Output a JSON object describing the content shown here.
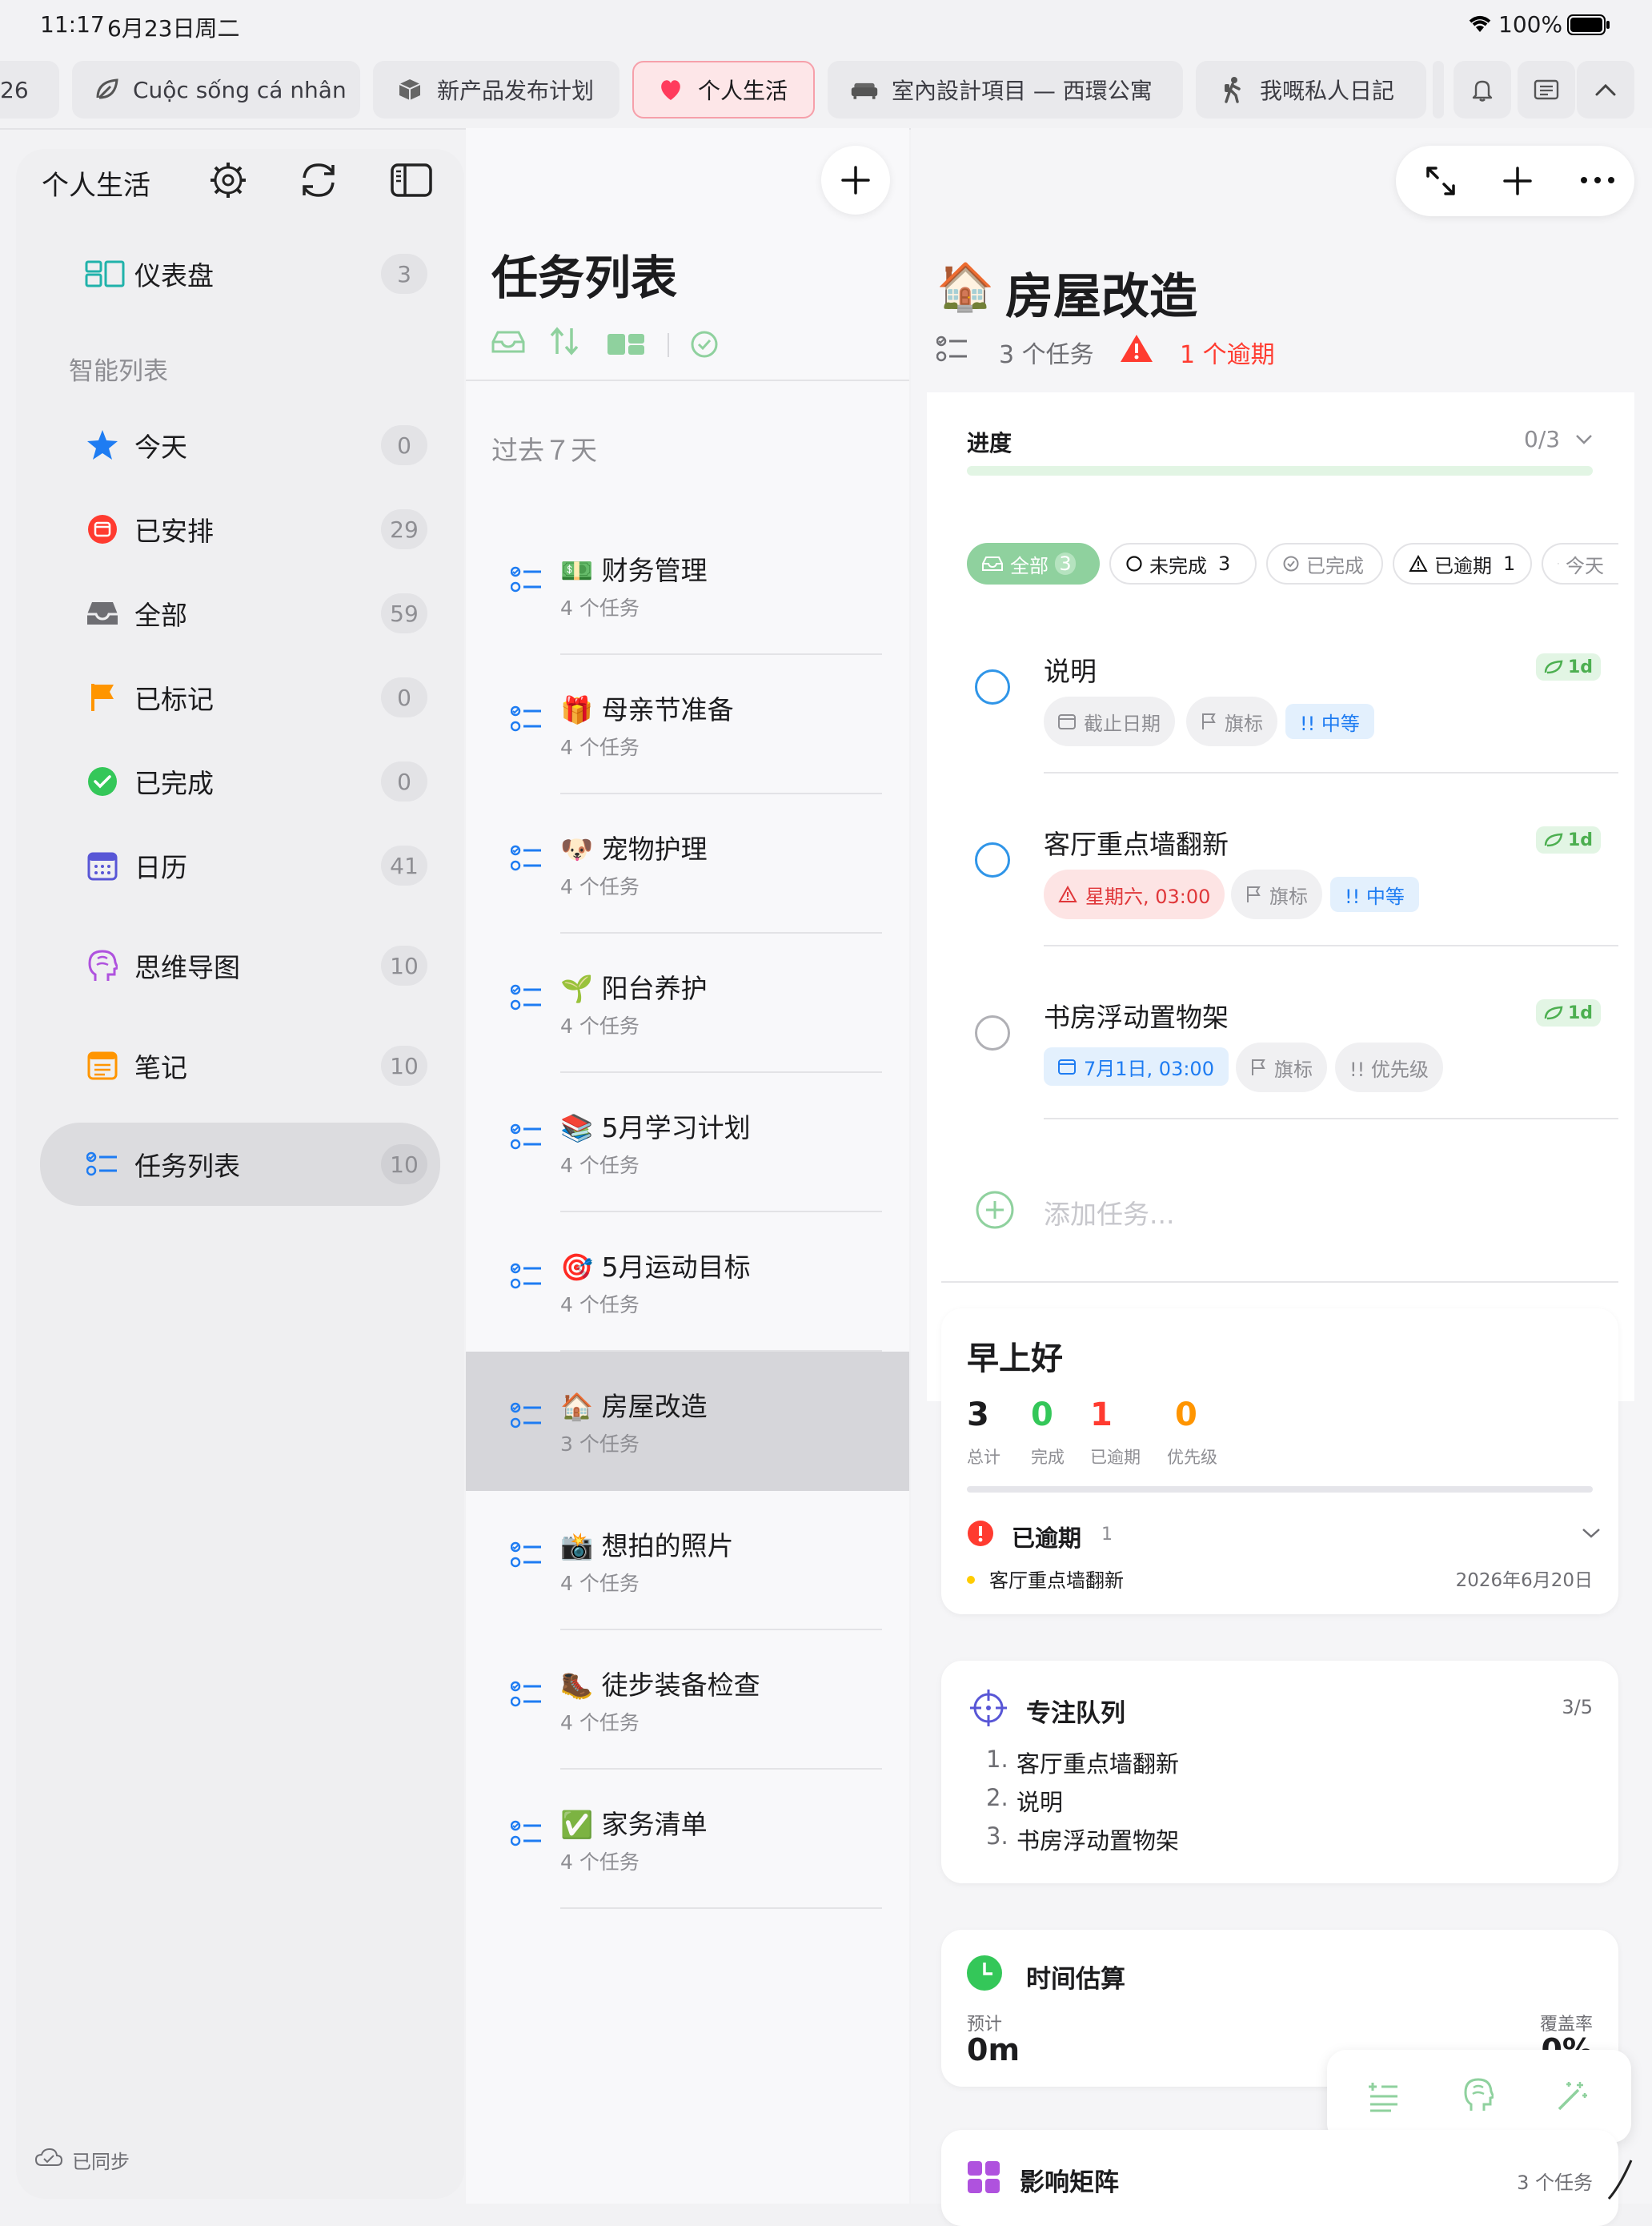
{
  "status": {
    "time": "11:17",
    "date": "6月23日周二",
    "battery": "100%"
  },
  "tabs": [
    {
      "label": "26",
      "icon": "partial-tab"
    },
    {
      "label": "Cuộc sống cá nhân",
      "icon": "leaf-icon"
    },
    {
      "label": "新产品发布计划",
      "icon": "box-icon"
    },
    {
      "label": "个人生活",
      "icon": "heart-icon",
      "active": true
    },
    {
      "label": "室內設計項目 — 西環公寓",
      "icon": "sofa-icon"
    },
    {
      "label": "我嘅私人日記",
      "icon": "hiker-icon"
    }
  ],
  "sidebar": {
    "title": "个人生活",
    "dashboard": {
      "label": "仪表盘",
      "count": "3"
    },
    "smart_header": "智能列表",
    "items": [
      {
        "label": "今天",
        "count": "0",
        "icon": "star-icon"
      },
      {
        "label": "已安排",
        "count": "29",
        "icon": "calendar-red-icon"
      },
      {
        "label": "全部",
        "count": "59",
        "icon": "inbox-icon"
      },
      {
        "label": "已标记",
        "count": "0",
        "icon": "flag-icon"
      },
      {
        "label": "已完成",
        "count": "0",
        "icon": "check-circle-icon"
      },
      {
        "label": "日历",
        "count": "41",
        "icon": "calendar-icon"
      },
      {
        "label": "思维导图",
        "count": "10",
        "icon": "brain-icon"
      },
      {
        "label": "笔记",
        "count": "10",
        "icon": "notes-icon"
      },
      {
        "label": "任务列表",
        "count": "10",
        "icon": "tasklist-icon"
      }
    ],
    "sync": "已同步"
  },
  "middle": {
    "title": "任务列表",
    "section": "过去７天",
    "lists": [
      {
        "emoji": "💵",
        "title": "财务管理",
        "sub": "4 个任务"
      },
      {
        "emoji": "🎁",
        "title": "母亲节准备",
        "sub": "4 个任务"
      },
      {
        "emoji": "🐶",
        "title": "宠物护理",
        "sub": "4 个任务"
      },
      {
        "emoji": "🌱",
        "title": "阳台养护",
        "sub": "4 个任务"
      },
      {
        "emoji": "📚",
        "title": "5月学习计划",
        "sub": "4 个任务"
      },
      {
        "emoji": "🎯",
        "title": "5月运动目标",
        "sub": "4 个任务"
      },
      {
        "emoji": "🏠",
        "title": "房屋改造",
        "sub": "3 个任务"
      },
      {
        "emoji": "📸",
        "title": "想拍的照片",
        "sub": "4 个任务"
      },
      {
        "emoji": "🥾",
        "title": "徒步装备检查",
        "sub": "4 个任务"
      },
      {
        "emoji": "✅",
        "title": "家务清单",
        "sub": "4 个任务"
      }
    ]
  },
  "detail": {
    "emoji": "🏠",
    "title": "房屋改造",
    "count": "3 个任务",
    "overdue": "1 个逾期",
    "progress_label": "进度",
    "progress_value": "0/3",
    "progress_fraction": 0,
    "filters": [
      {
        "label": "全部",
        "count": "3"
      },
      {
        "label": "未完成",
        "count": "3"
      },
      {
        "label": "已完成",
        "count": ""
      },
      {
        "label": "已逾期",
        "count": "1"
      },
      {
        "label": "今天",
        "count": ""
      }
    ],
    "tasks": [
      {
        "title": "说明",
        "badge": "1d",
        "date": "截止日期",
        "flag": "旗标",
        "priority": "!! 中等"
      },
      {
        "title": "客厅重点墙翻新",
        "badge": "1d",
        "date": "星期六, 03:00",
        "flag": "旗标",
        "priority": "!! 中等"
      },
      {
        "title": "书房浮动置物架",
        "badge": "1d",
        "date": "7月1日, 03:00",
        "flag": "旗标",
        "priority": "!! 优先级"
      }
    ],
    "add_placeholder": "添加任务..."
  },
  "greeting": {
    "title": "早上好",
    "stats": [
      {
        "value": "3",
        "label": "总计",
        "color": "#1c1c1e"
      },
      {
        "value": "0",
        "label": "完成",
        "color": "#34c759"
      },
      {
        "value": "1",
        "label": "已逾期",
        "color": "#ff3b30"
      },
      {
        "value": "0",
        "label": "优先级",
        "color": "#ff9500"
      }
    ],
    "overdue_title": "已逾期",
    "overdue_count": "1",
    "overdue_item": "客厅重点墙翻新",
    "overdue_date": "2026年6月20日"
  },
  "focus": {
    "title": "专注队列",
    "count": "3/5",
    "items": [
      "客厅重点墙翻新",
      "说明",
      "书房浮动置物架"
    ],
    "nums": [
      "1.",
      "2.",
      "3."
    ]
  },
  "estimate": {
    "title": "时间估算",
    "planned_label": "预计",
    "planned_value": "0m",
    "coverage_label": "覆盖率",
    "coverage_value": "0%"
  },
  "matrix": {
    "title": "影响矩阵",
    "count": "3 个任务"
  }
}
